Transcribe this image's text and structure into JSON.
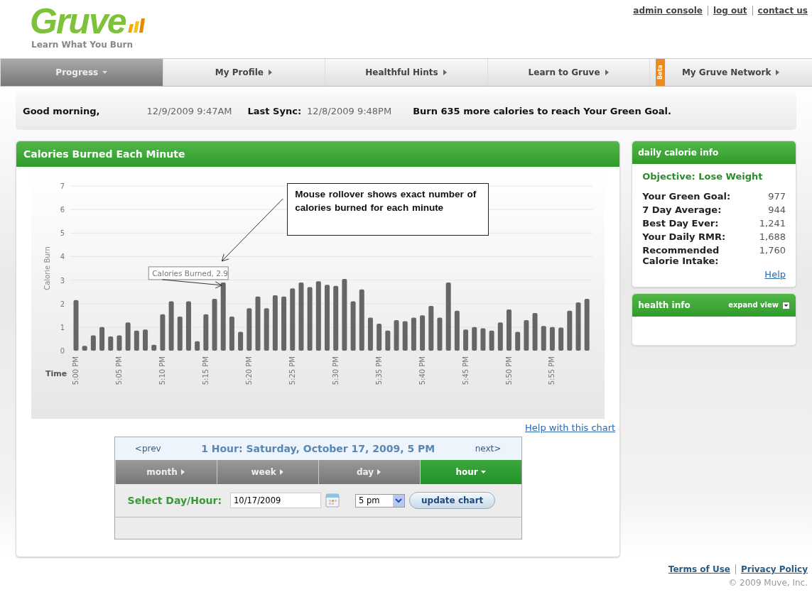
{
  "logo": {
    "name": "Gruve",
    "tagline": "Learn What You Burn"
  },
  "top_links": [
    "admin console",
    "log out",
    "contact us"
  ],
  "nav": [
    {
      "label": "Progress",
      "selected": true
    },
    {
      "label": "My Profile",
      "selected": false
    },
    {
      "label": "Healthful Hints",
      "selected": false
    },
    {
      "label": "Learn to Gruve",
      "selected": false
    },
    {
      "label": "My Gruve Network",
      "selected": false,
      "badge": "Beta"
    }
  ],
  "status": {
    "greeting": "Good morning,",
    "now": "12/9/2009 9:47AM",
    "sync_label": "Last Sync:",
    "sync": "12/8/2009 9:48PM",
    "message": "Burn 635 more calories to reach Your Green Goal."
  },
  "chart_panel": {
    "title": "Calories Burned Each Minute",
    "chart_data": {
      "type": "bar",
      "xlabel": "Time",
      "ylabel": "Calorie Burn",
      "categories": [
        "5:00 PM",
        null,
        null,
        null,
        null,
        "5:05 PM",
        null,
        null,
        null,
        null,
        "5:10 PM",
        null,
        null,
        null,
        null,
        "5:15 PM",
        null,
        null,
        null,
        null,
        "5:20 PM",
        null,
        null,
        null,
        null,
        "5:25 PM",
        null,
        null,
        null,
        null,
        "5:30 PM",
        null,
        null,
        null,
        null,
        "5:35 PM",
        null,
        null,
        null,
        null,
        "5:40 PM",
        null,
        null,
        null,
        null,
        "5:45 PM",
        null,
        null,
        null,
        null,
        "5:50 PM",
        null,
        null,
        null,
        null,
        "5:55 PM",
        null,
        null,
        null,
        null
      ],
      "values": [
        2.15,
        0.2,
        0.65,
        1.0,
        0.6,
        0.65,
        1.2,
        0.85,
        0.9,
        0.25,
        1.55,
        2.1,
        1.45,
        2.1,
        0.4,
        1.55,
        2.2,
        2.9,
        1.45,
        0.8,
        1.8,
        2.3,
        1.8,
        2.35,
        2.3,
        2.65,
        2.9,
        2.7,
        2.95,
        2.8,
        2.75,
        3.05,
        2.1,
        2.6,
        1.4,
        1.15,
        0.85,
        1.3,
        1.25,
        1.4,
        1.5,
        1.9,
        1.4,
        2.9,
        1.7,
        0.9,
        1.0,
        0.95,
        0.85,
        1.2,
        1.75,
        0.8,
        1.3,
        1.6,
        1.05,
        1.0,
        0.98,
        1.7,
        2.05,
        2.2
      ],
      "ylim": [
        0,
        7
      ],
      "yticks": [
        0,
        1,
        2,
        3,
        4,
        5,
        6,
        7
      ],
      "grid": true,
      "annotations": [
        "Calories Burned, 2.9",
        "Mouse rollover shows exact number of calories burned for each minute"
      ]
    },
    "help_link": "Help with this chart",
    "period": {
      "prev": "<prev",
      "title": "1 Hour: Saturday, October 17, 2009, 5 PM",
      "next": "next>",
      "tabs": [
        {
          "label": "month",
          "selected": false
        },
        {
          "label": "week",
          "selected": false
        },
        {
          "label": "day",
          "selected": false
        },
        {
          "label": "hour",
          "selected": true
        }
      ],
      "select_label": "Select Day/Hour:",
      "date": "10/17/2009",
      "hour": "5 pm",
      "button": "update chart"
    }
  },
  "daily_info": {
    "title": "daily calorie info",
    "objective": "Objective: Lose Weight",
    "rows": [
      {
        "label": "Your Green Goal:",
        "value": "977"
      },
      {
        "label": "7 Day Average:",
        "value": "944"
      },
      {
        "label": "Best Day Ever:",
        "value": "1,241"
      },
      {
        "label": "Your Daily RMR:",
        "value": "1,688"
      },
      {
        "label": "Recommended Calorie Intake:",
        "value": "1,760"
      }
    ],
    "help": "Help"
  },
  "health_info": {
    "title": "health info",
    "expand": "expand view",
    "expanded": false
  },
  "footer": {
    "links": [
      "Terms of Use",
      "Privacy Policy"
    ],
    "copyright": "© 2009 Muve, Inc."
  }
}
